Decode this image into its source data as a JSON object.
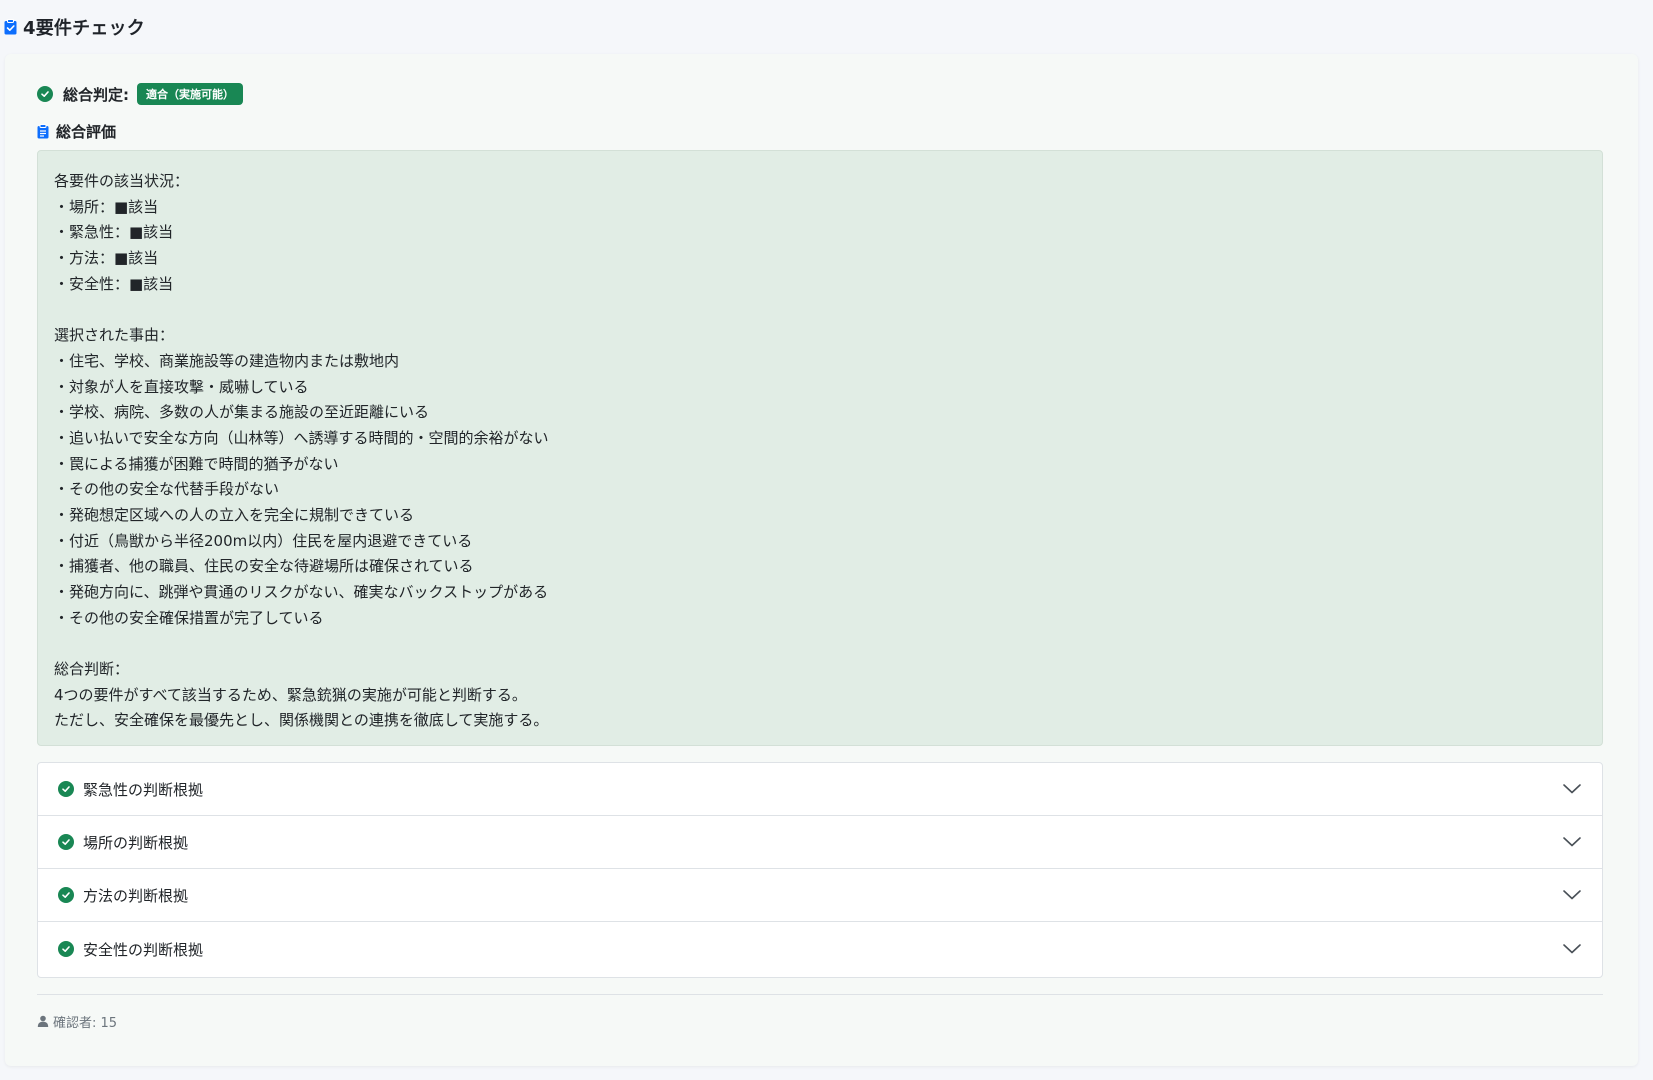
{
  "header": {
    "title": "4要件チェック",
    "icon": "clipboard-check-icon"
  },
  "overall": {
    "label": "総合判定:",
    "badge": "適合（実施可能）",
    "icon": "check-circle-icon"
  },
  "evaluation": {
    "title": "総合評価",
    "icon": "clipboard-icon",
    "lines": [
      "各要件の該当状況：",
      "・場所：■該当",
      "・緊急性：■該当",
      "・方法：■該当",
      "・安全性：■該当",
      "",
      "選択された事由：",
      "・住宅、学校、商業施設等の建造物内または敷地内",
      "・対象が人を直接攻撃・威嚇している",
      "・学校、病院、多数の人が集まる施設の至近距離にいる",
      "・追い払いで安全な方向（山林等）へ誘導する時間的・空間的余裕がない",
      "・罠による捕獲が困難で時間的猶予がない",
      "・その他の安全な代替手段がない",
      "・発砲想定区域への人の立入を完全に規制できている",
      "・付近（鳥獣から半径200m以内）住民を屋内退避できている",
      "・捕獲者、他の職員、住民の安全な待避場所は確保されている",
      "・発砲方向に、跳弾や貫通のリスクがない、確実なバックストップがある",
      "・その他の安全確保措置が完了している",
      "",
      "総合判断：",
      "4つの要件がすべて該当するため、緊急銃猟の実施が可能と判断する。",
      "ただし、安全確保を最優先とし、関係機関との連携を徹底して実施する。"
    ]
  },
  "accordion": [
    {
      "label": "緊急性の判断根拠"
    },
    {
      "label": "場所の判断根拠"
    },
    {
      "label": "方法の判断根拠"
    },
    {
      "label": "安全性の判断根拠"
    }
  ],
  "footer": {
    "confirmer": "確認者: 15",
    "icon": "person-icon"
  },
  "colors": {
    "accent_blue": "#0d6efd",
    "success_green": "#198754",
    "eval_bg": "#e1ede5"
  }
}
